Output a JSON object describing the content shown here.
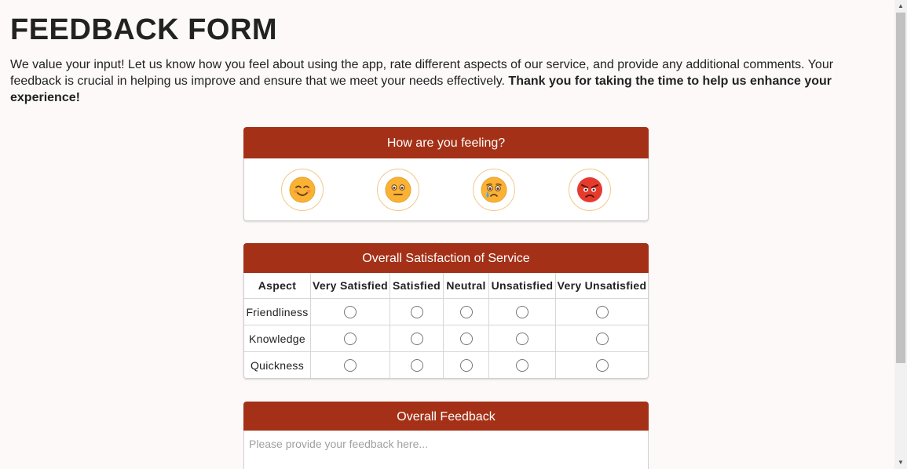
{
  "page": {
    "title": "FEEDBACK FORM",
    "intro_text": "We value your input! Let us know how you feel about using the app, rate different aspects of our service, and provide any additional comments. Your feedback is crucial in helping us improve and ensure that we meet your needs effectively. ",
    "intro_bold": "Thank you for taking the time to help us enhance your experience!"
  },
  "mood": {
    "title": "How are you feeling?",
    "options": [
      {
        "icon": "smiling-face-icon",
        "color": "#f7a833"
      },
      {
        "icon": "neutral-face-icon",
        "color": "#f7a833"
      },
      {
        "icon": "crying-face-icon",
        "color": "#f7a833"
      },
      {
        "icon": "angry-face-icon",
        "color": "#e53b2e"
      }
    ]
  },
  "satisfaction": {
    "title": "Overall Satisfaction of Service",
    "columns": [
      "Aspect",
      "Very Satisfied",
      "Satisfied",
      "Neutral",
      "Unsatisfied",
      "Very Unsatisfied"
    ],
    "rows": [
      "Friendliness",
      "Knowledge",
      "Quickness"
    ]
  },
  "feedback": {
    "title": "Overall Feedback",
    "placeholder": "Please provide your feedback here...",
    "value": ""
  },
  "colors": {
    "accent": "#a43117",
    "background": "#fdf9f9"
  }
}
